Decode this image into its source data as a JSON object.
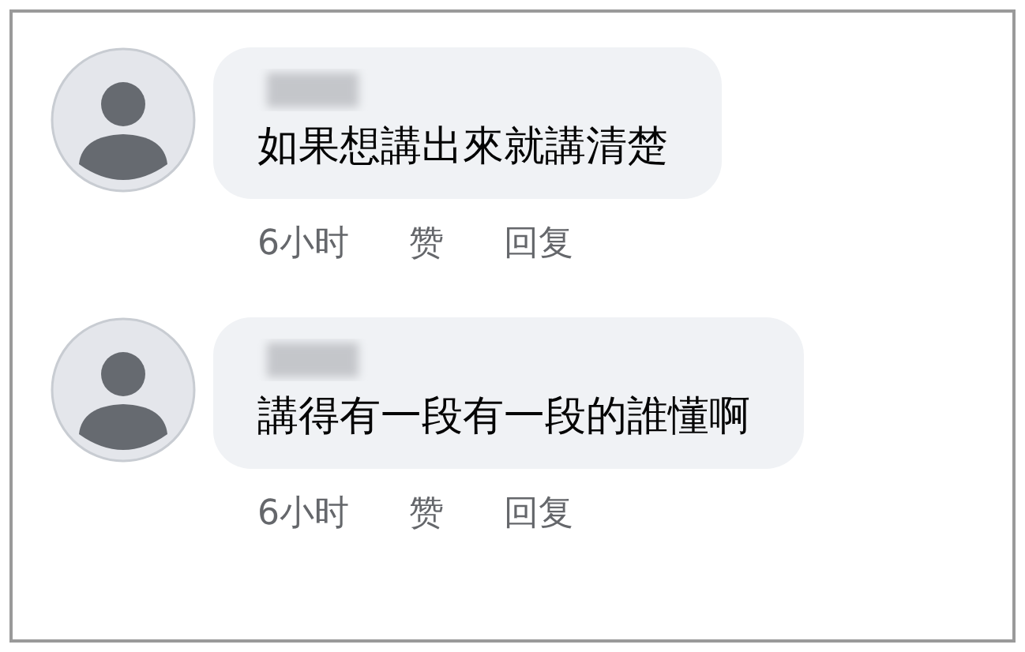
{
  "comments": [
    {
      "text": "如果想講出來就講清楚",
      "time": "6小时",
      "actions": [
        "赞",
        "回复"
      ]
    },
    {
      "text": "講得有一段有一段的誰懂啊",
      "time": "6小时",
      "actions": [
        "赞",
        "回复"
      ]
    }
  ]
}
